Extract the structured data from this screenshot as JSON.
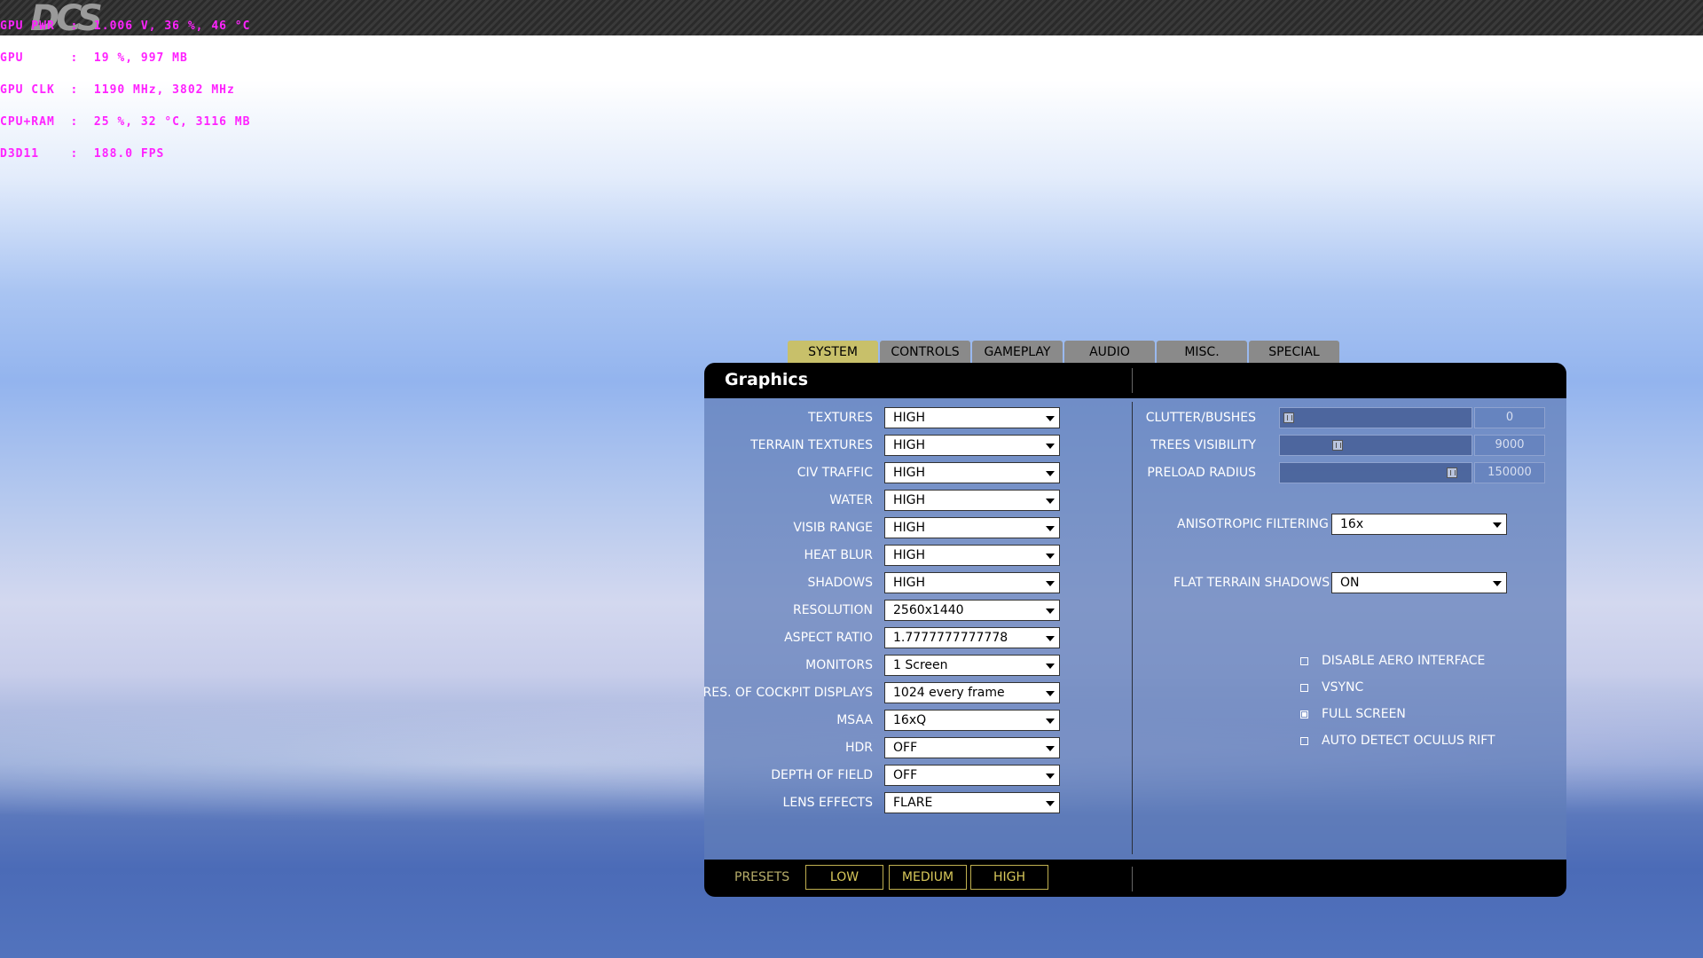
{
  "overlay": {
    "logo": "DCS",
    "lines": [
      "GPU PWR  :  1.006 V, 36 %, 46 °C",
      "GPU      :  19 %, 997 MB",
      "GPU CLK  :  1190 MHz, 3802 MHz",
      "CPU+RAM  :  25 %, 32 °C, 3116 MB",
      "D3D11    :  188.0 FPS"
    ]
  },
  "tabs": [
    {
      "label": "SYSTEM",
      "active": true
    },
    {
      "label": "CONTROLS",
      "active": false
    },
    {
      "label": "GAMEPLAY",
      "active": false
    },
    {
      "label": "AUDIO",
      "active": false
    },
    {
      "label": "MISC.",
      "active": false
    },
    {
      "label": "SPECIAL",
      "active": false
    }
  ],
  "panel": {
    "title": "Graphics"
  },
  "left_settings": [
    {
      "label": "TEXTURES",
      "value": "HIGH"
    },
    {
      "label": "TERRAIN TEXTURES",
      "value": "HIGH"
    },
    {
      "label": "CIV TRAFFIC",
      "value": "HIGH"
    },
    {
      "label": "WATER",
      "value": "HIGH"
    },
    {
      "label": "VISIB RANGE",
      "value": "HIGH"
    },
    {
      "label": "HEAT BLUR",
      "value": "HIGH"
    },
    {
      "label": "SHADOWS",
      "value": "HIGH"
    },
    {
      "label": "RESOLUTION",
      "value": "2560x1440"
    },
    {
      "label": "ASPECT RATIO",
      "value": "1.7777777777778"
    },
    {
      "label": "MONITORS",
      "value": "1 Screen"
    },
    {
      "label": "RES. OF COCKPIT DISPLAYS",
      "value": "1024 every frame"
    },
    {
      "label": "MSAA",
      "value": "16xQ"
    },
    {
      "label": "HDR",
      "value": "OFF"
    },
    {
      "label": "DEPTH OF FIELD",
      "value": "OFF"
    },
    {
      "label": "LENS EFFECTS",
      "value": "FLARE"
    }
  ],
  "sliders": [
    {
      "label": "CLUTTER/BUSHES",
      "value": "0",
      "position": 0.0
    },
    {
      "label": "TREES VISIBILITY",
      "value": "9000",
      "position": 0.28
    },
    {
      "label": "PRELOAD RADIUS",
      "value": "150000",
      "position": 0.94
    }
  ],
  "right_selects": [
    {
      "label": "ANISOTROPIC FILTERING",
      "value": "16x"
    },
    {
      "label": "FLAT TERRAIN SHADOWS",
      "value": "ON"
    }
  ],
  "checkboxes": [
    {
      "label": "DISABLE AERO INTERFACE",
      "checked": false
    },
    {
      "label": "VSYNC",
      "checked": false
    },
    {
      "label": "FULL SCREEN",
      "checked": true
    },
    {
      "label": "AUTO DETECT OCULUS RIFT",
      "checked": false
    }
  ],
  "footer": {
    "presets_label": "PRESETS",
    "buttons": [
      "LOW",
      "MEDIUM",
      "HIGH"
    ]
  },
  "colors": {
    "active_tab": "#c8c06a",
    "inactive_tab": "#8a8a8a",
    "preset_text": "#d8c85a",
    "overlay_text": "#ff22ff"
  }
}
